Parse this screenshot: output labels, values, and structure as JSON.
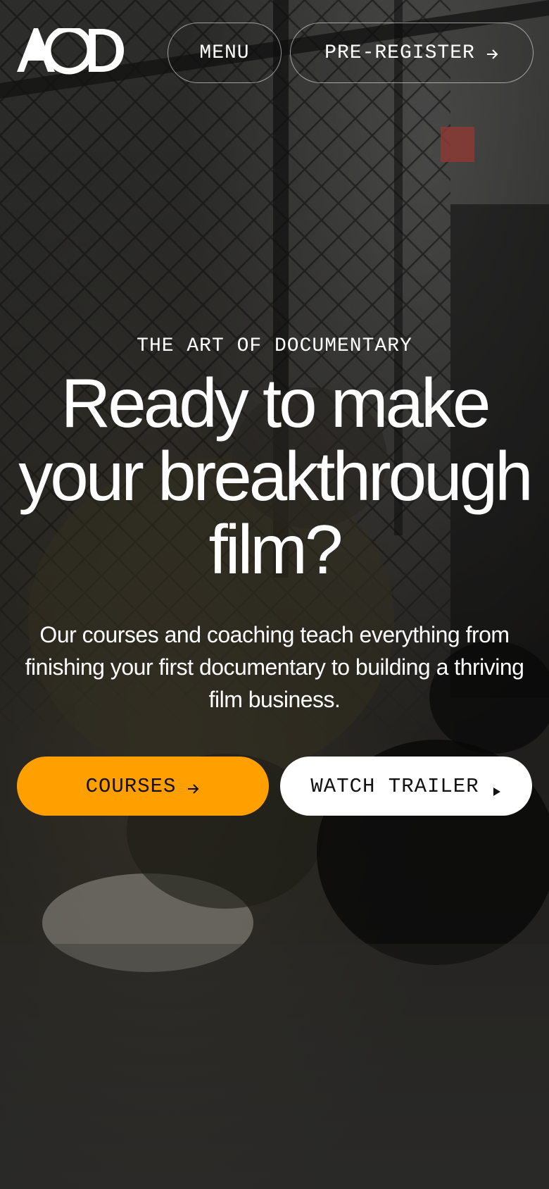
{
  "header": {
    "logo_text": "AOD",
    "menu_label": "MENU",
    "preregister_label": "PRE-REGISTER",
    "preregister_icon": "arrow-right-icon"
  },
  "hero": {
    "eyebrow": "THE ART OF DOCUMENTARY",
    "headline": "Ready to make your breakthrough film?",
    "subtitle": "Our courses and coaching teach everything from finishing your first documentary to building a thriving film business."
  },
  "cta": {
    "courses_label": "COURSES",
    "courses_icon": "arrow-right-icon",
    "trailer_label": "WATCH TRAILER",
    "trailer_icon": "play-icon"
  },
  "colors": {
    "accent": "#ff9f00",
    "text": "#ffffff",
    "button_dark_text": "#111111"
  }
}
